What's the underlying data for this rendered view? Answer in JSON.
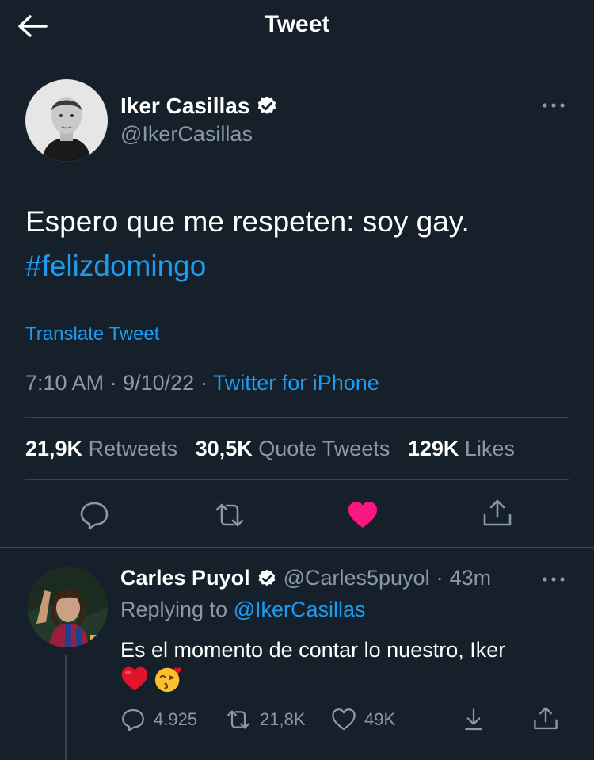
{
  "header": {
    "title": "Tweet",
    "back_icon": "arrow-left-icon"
  },
  "tweet": {
    "author_name": "Iker Casillas",
    "author_handle": "@IkerCasillas",
    "verified": true,
    "text": "Espero que me respeten: soy gay.",
    "hashtag": "#felizdomingo",
    "translate_label": "Translate Tweet",
    "time": "7:10 AM",
    "date": "9/10/22",
    "separator": "·",
    "source": "Twitter for iPhone",
    "stats": {
      "retweets_count": "21,9K",
      "retweets_label": "Retweets",
      "quotes_count": "30,5K",
      "quotes_label": "Quote Tweets",
      "likes_count": "129K",
      "likes_label": "Likes"
    },
    "liked": true,
    "colors": {
      "like": "#f91880",
      "link": "#1d9bf0",
      "background": "#15202b"
    }
  },
  "reply": {
    "author_name": "Carles Puyol",
    "author_handle": "@Carles5puyol",
    "separator": "·",
    "age": "43m",
    "replying_prefix": "Replying to",
    "replying_to": "@IkerCasillas",
    "text": "Es el momento de contar lo nuestro, Iker",
    "emojis": [
      "red-heart-emoji",
      "kissing-face-emoji"
    ],
    "counts": {
      "replies": "4.925",
      "retweets": "21,8K",
      "likes": "49K"
    }
  }
}
